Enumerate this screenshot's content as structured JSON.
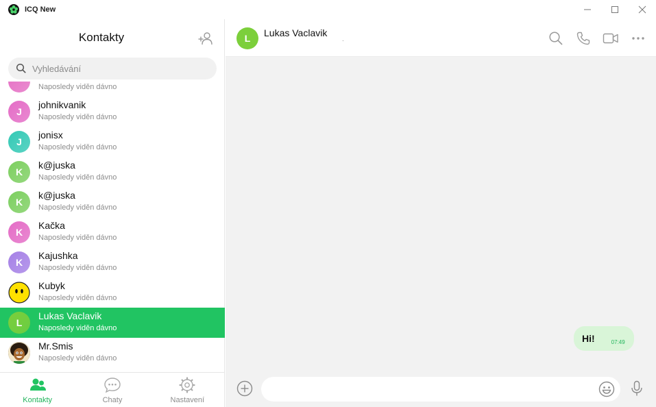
{
  "app": {
    "title": "ICQ New"
  },
  "left": {
    "title": "Kontakty",
    "search_placeholder": "Vyhledávání"
  },
  "contacts": [
    {
      "initial": "",
      "name": "",
      "status": "Naposledy viděn dávno",
      "color": "#e56fc4",
      "selected": false
    },
    {
      "initial": "J",
      "name": "johnikvanik",
      "status": "Naposledy viděn dávno",
      "color": "#e46cc6",
      "selected": false
    },
    {
      "initial": "J",
      "name": "jonisx",
      "status": "Naposledy viděn dávno",
      "color": "#33c9b5",
      "selected": false
    },
    {
      "initial": "K",
      "name": "k@juska",
      "status": "Naposledy viděn dávno",
      "color": "#7ccf5f",
      "selected": false
    },
    {
      "initial": "K",
      "name": "k@juska",
      "status": "Naposledy viděn dávno",
      "color": "#7ccf5f",
      "selected": false
    },
    {
      "initial": "K",
      "name": "Kačka",
      "status": "Naposledy viděn dávno",
      "color": "#e46cc6",
      "selected": false
    },
    {
      "initial": "K",
      "name": "Kajushka",
      "status": "Naposledy viděn dávno",
      "color": "#a580e6",
      "selected": false
    },
    {
      "initial": "",
      "name": "Kubyk",
      "status": "Naposledy viděn dávno",
      "color": "#ffe100",
      "selected": false,
      "avatar": "smiley"
    },
    {
      "initial": "L",
      "name": "Lukas Vaclavik",
      "status": "Naposledy viděn dávno",
      "color": "#7ccf3b",
      "selected": true
    },
    {
      "initial": "",
      "name": "Mr.Smis",
      "status": "Naposledy viděn dávno",
      "color": "#3a2a1c",
      "selected": false,
      "avatar": "photo"
    }
  ],
  "tabs": [
    {
      "label": "Kontakty",
      "icon": "contacts-icon",
      "active": true
    },
    {
      "label": "Chaty",
      "icon": "chats-icon",
      "active": false
    },
    {
      "label": "Nastavení",
      "icon": "settings-gear-icon",
      "active": false
    }
  ],
  "chat": {
    "initial": "L",
    "name": "Lukas Vaclavik",
    "status": ".",
    "avatar_color": "#7ccf3b",
    "message_text": "Hi!",
    "message_time": "07:49",
    "input_placeholder": ""
  },
  "colors": {
    "accent": "#21c462",
    "accent_text": "#21b45b",
    "bubble": "#d9f5d8",
    "chat_bg": "#f2f2f2"
  }
}
